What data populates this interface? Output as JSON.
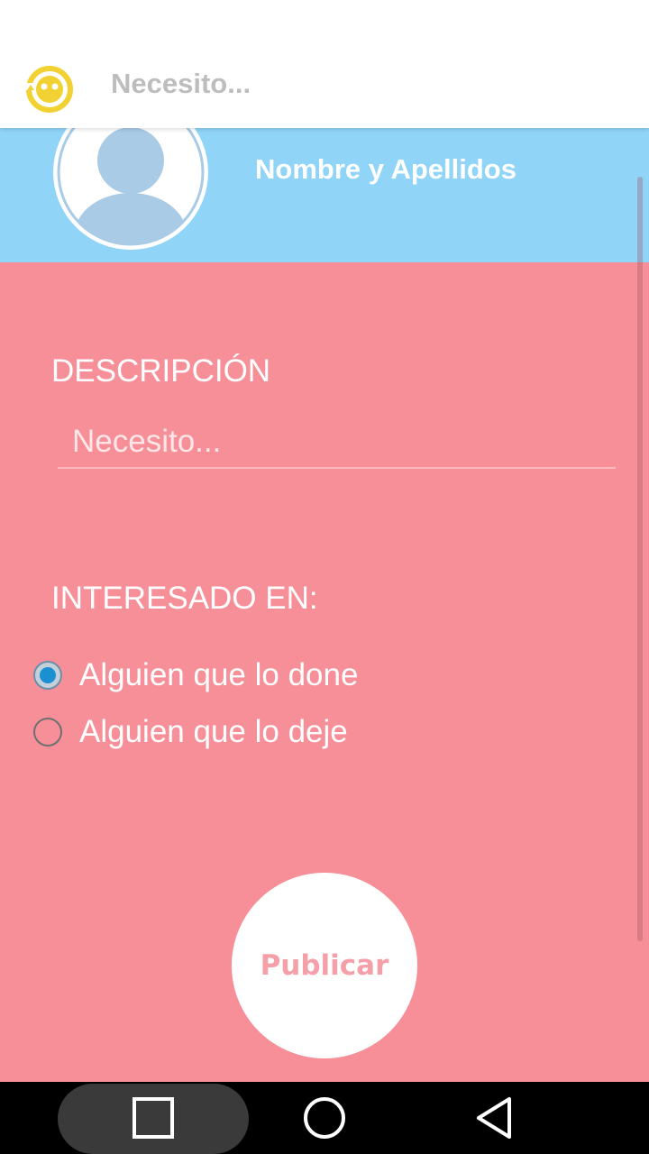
{
  "app_bar": {
    "title": "Necesito..."
  },
  "profile": {
    "name": "Nombre y Apellidos"
  },
  "form": {
    "description_label": "DESCRIPCIÓN",
    "description_placeholder": "Necesito...",
    "description_value": "",
    "interest_label": "INTERESADO EN:",
    "options": [
      {
        "label": "Alguien que lo done",
        "selected": true
      },
      {
        "label": "Alguien que lo deje",
        "selected": false
      }
    ],
    "publish_label": "Publicar"
  },
  "colors": {
    "app_bar_bg": "#ffffff",
    "header_bg": "#90d4f7",
    "body_bg": "#f78f99",
    "logo": "#f2d132",
    "radio_accent": "#1a8fd1",
    "publish_text": "#f5a0a8"
  },
  "icons": {
    "logo": "smiley-logo-icon",
    "avatar": "default-avatar-icon",
    "nav_recent": "square-recent-apps-icon",
    "nav_home": "circle-home-icon",
    "nav_back": "triangle-back-icon"
  }
}
